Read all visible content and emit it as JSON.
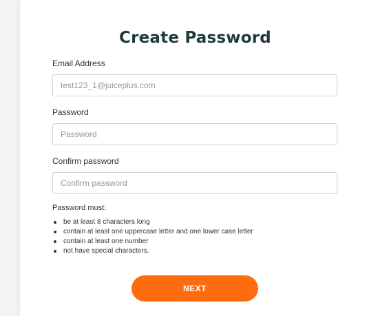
{
  "form": {
    "title": "Create Password",
    "email_label": "Email Address",
    "email_value": "test123_1@juiceplus.com",
    "password_label": "Password",
    "password_placeholder": "Password",
    "confirm_label": "Confirm password",
    "confirm_placeholder": "Confirm password",
    "rules_title": "Password must:",
    "rules": [
      "be at least 8 characters long",
      "contain at least one uppercase letter and one lower case letter",
      "contain at least one number",
      "not have special characters."
    ],
    "next_label": "NEXT"
  },
  "colors": {
    "accent": "#ff6b0f",
    "title": "#1f3a3a"
  }
}
